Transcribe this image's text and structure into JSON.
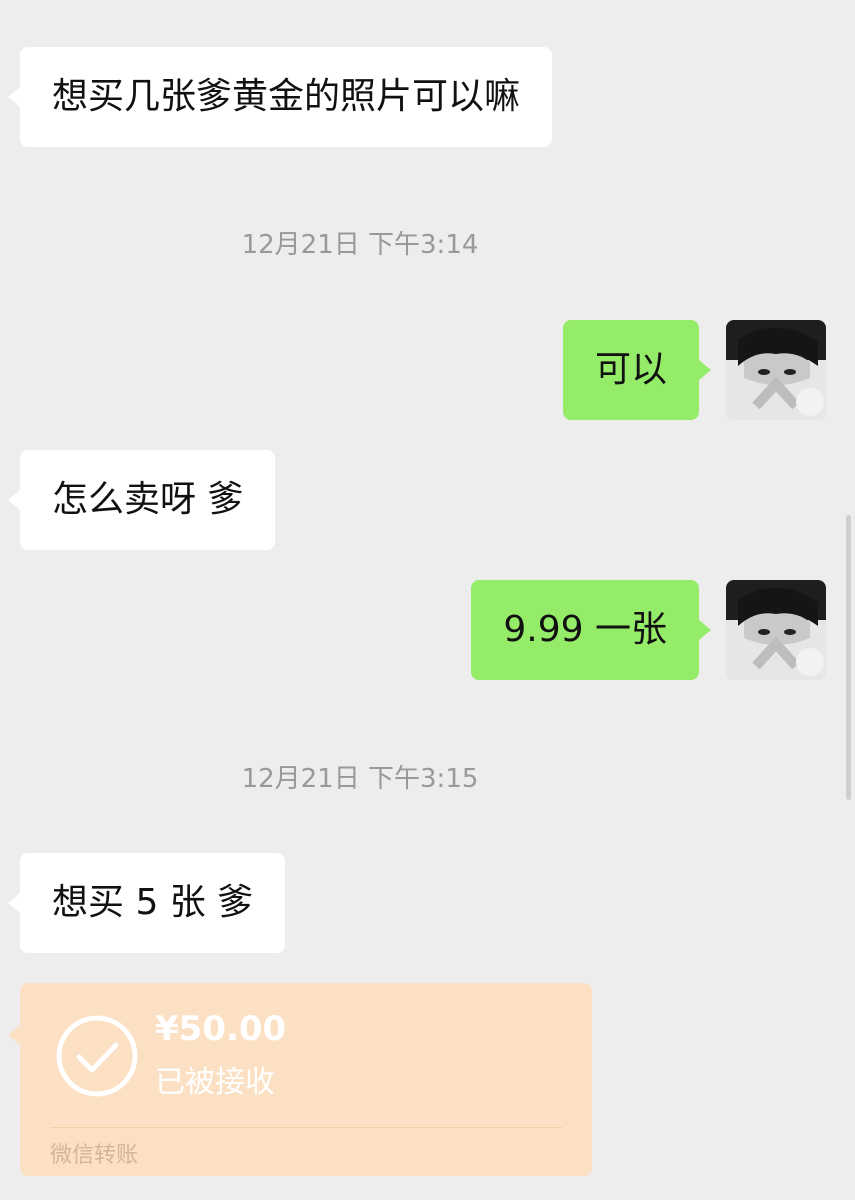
{
  "messages": [
    {
      "text": "想买几张爹黄金的照片可以嘛"
    },
    {
      "text": "可以"
    },
    {
      "text": "怎么卖呀 爹"
    },
    {
      "text": "9.99 一张"
    },
    {
      "text": "想买 5 张 爹"
    }
  ],
  "timestamps": [
    "12月21日 下午3:14",
    "12月21日 下午3:15"
  ],
  "transfer": {
    "amount": "¥50.00",
    "status": "已被接收",
    "label": "微信转账",
    "icon": "check-circle-icon",
    "color": "#fbe0c3"
  },
  "colors": {
    "background": "#ededed",
    "incoming_bubble": "#ffffff",
    "outgoing_bubble": "#95ec69"
  }
}
